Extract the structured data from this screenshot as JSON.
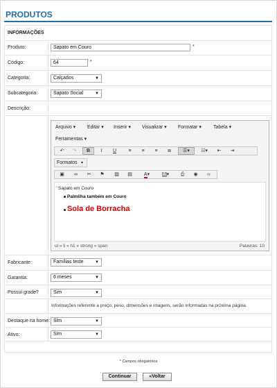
{
  "page": {
    "title": "PRODUTOS",
    "section": "INFORMAÇÕES"
  },
  "form": {
    "produto": {
      "label": "Produto:",
      "value": "Sapato em Couro",
      "req": "*"
    },
    "codigo": {
      "label": "Código:",
      "value": "64",
      "req": "*"
    },
    "categoria": {
      "label": "Categoria:",
      "value": "Calçados"
    },
    "subcategoria": {
      "label": "Subcategoria:",
      "value": "Sapato Social"
    },
    "descricao": {
      "label": "Descrição:"
    },
    "fabricante": {
      "label": "Fabricante:",
      "value": "Famílias teste"
    },
    "garantia": {
      "label": "Garantia:",
      "value": "6 meses"
    },
    "grade": {
      "label": "Possui grade?",
      "value": "Sim"
    },
    "info_text": "Informações referente a preço, peso, dimensões e imagens, serão informadas na próxima página.",
    "destaque": {
      "label": "Destaque na home:",
      "value": "Sim"
    },
    "ativo": {
      "label": "Ativo:",
      "value": "Sim"
    }
  },
  "editor": {
    "menu": [
      "Arquivo",
      "Editar",
      "Inserir",
      "Visualizar",
      "Formatar",
      "Tabela",
      "Ferramentas"
    ],
    "formats_label": "Formatos",
    "content": {
      "paragraph": "Sapato em Couro",
      "item1": "Palmilha também em Couro",
      "item2": "Sola de Borracha"
    },
    "status_path": "ul » li » h1 » strong » span",
    "word_count": "Palavras: 10",
    "colors": {
      "highlight": "#e00000"
    }
  },
  "footer": {
    "note": "* Campos obrigatórios",
    "continue": "Continuar",
    "back": "«Voltar"
  },
  "colors": {
    "accent": "#1d6fb0"
  }
}
